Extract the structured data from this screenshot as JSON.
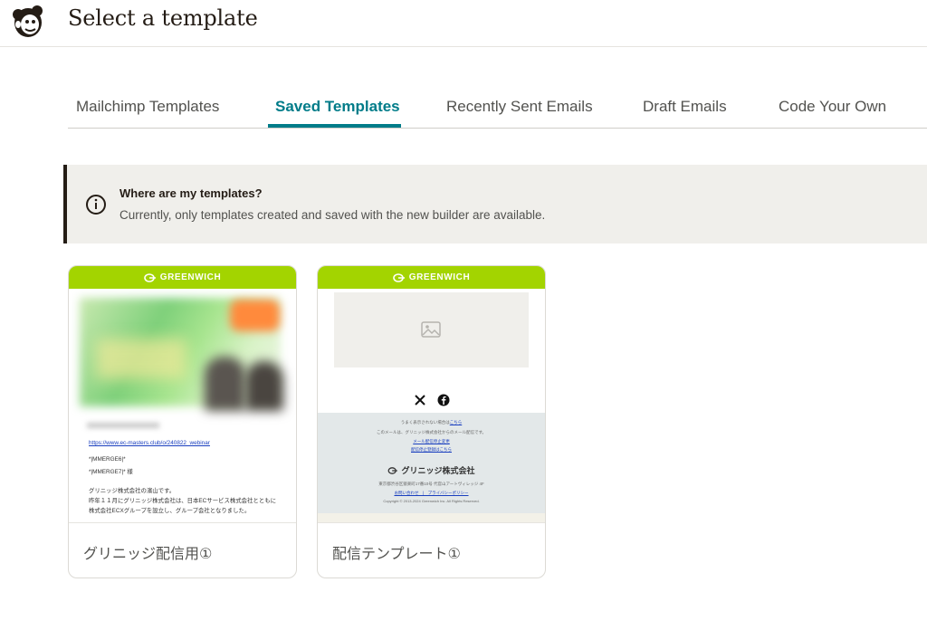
{
  "header": {
    "title": "Select a template"
  },
  "tabs": [
    {
      "label": "Mailchimp Templates"
    },
    {
      "label": "Saved Templates"
    },
    {
      "label": "Recently Sent Emails"
    },
    {
      "label": "Draft Emails"
    },
    {
      "label": "Code Your Own"
    }
  ],
  "active_tab": "Saved Templates",
  "banner": {
    "title": "Where are my templates?",
    "text": "Currently, only templates created and saved with the new builder are available."
  },
  "cards": [
    {
      "name": "グリニッジ配信用①",
      "brand": "GREENWICH",
      "preview": {
        "link": "https://www.ec-masters.club/o/240822_webinar",
        "merge1": "*|MMERGE6|*",
        "merge2": "*|MMERGE7|* 様",
        "body1": "グリニッジ株式会社の濱山です。",
        "body2": "昨年１１月にグリニッジ株式会社は、日本ECサービス株式会社とともに",
        "body3": "株式会社ECXグループを設立し、グループ会社となりました。"
      }
    },
    {
      "name": "配信テンプレート①",
      "brand": "GREENWICH",
      "preview": {
        "line1": "うまく表示されない場合は",
        "line1_link": "こちら",
        "line2": "このメールは、グリニッジ株式会社からのメール配信です。",
        "line3": "メール配信停止変更",
        "line4": "配信停止登録はこちら",
        "company": "グリニッジ株式会社",
        "address": "東京都渋谷区猿楽町17番10号 代官山アートヴィレッジ 4F",
        "links": "お問い合わせ　|　プライバシーポリシー",
        "copyright": "Copyright © 2013-2024 Greenwich Inc. All Rights Reserved."
      }
    }
  ],
  "colors": {
    "accent": "#007c89",
    "brand_green": "#a3d400",
    "banner_bg": "#f0efeb"
  }
}
